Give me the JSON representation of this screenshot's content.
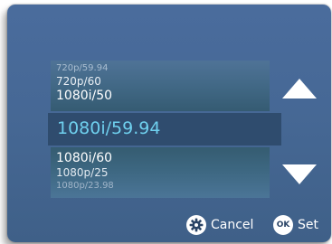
{
  "picker": {
    "options_above": [
      "720p/59.94",
      "720p/60",
      "1080i/50"
    ],
    "selected": "1080i/59.94",
    "options_below": [
      "1080i/60",
      "1080p/25",
      "1080p/23.98"
    ]
  },
  "icons": {
    "scroll_up": "triangle-up-icon",
    "scroll_down": "triangle-down-icon",
    "cancel": "gear-icon",
    "set": "ok-icon"
  },
  "footer": {
    "cancel_label": "Cancel",
    "set_badge": "OK",
    "set_label": "Set"
  },
  "colors": {
    "panel": "#466895",
    "selected_text": "#6fd0ee",
    "selected_bar": "#2f4c6e"
  }
}
